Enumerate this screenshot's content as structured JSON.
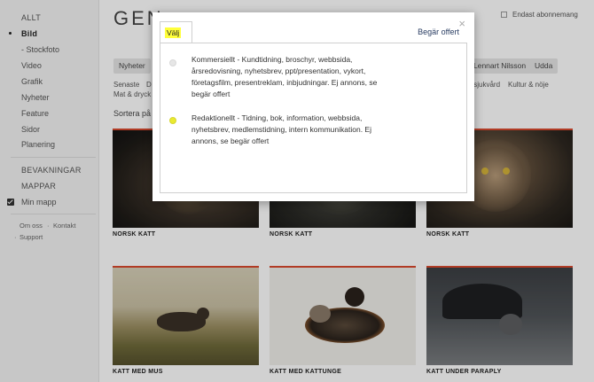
{
  "sidebar": {
    "items": [
      {
        "label": "ALLT"
      },
      {
        "label": "Bild"
      },
      {
        "label": "- Stockfoto"
      },
      {
        "label": "Video"
      },
      {
        "label": "Grafik"
      },
      {
        "label": "Nyheter"
      },
      {
        "label": "Feature"
      },
      {
        "label": "Sidor"
      },
      {
        "label": "Planering"
      }
    ],
    "sections": [
      "BEVAKNINGAR",
      "MAPPAR"
    ],
    "my_folder": "Min mapp",
    "footer": {
      "about": "Om oss",
      "contact": "Kontakt",
      "support": "Support"
    }
  },
  "main": {
    "title": "GEN",
    "subscription_label": "Endast abonnemang",
    "tags": [
      "Nyheter",
      "Lennart Nilsson",
      "Udda"
    ],
    "links": {
      "latest": "Senaste",
      "latest_d": "D",
      "sjukvard": "s sjukvård",
      "kultur": "Kultur & nöje",
      "mat": "Mat & dryck"
    },
    "sort_label": "Sortera på",
    "cards": [
      {
        "caption": "NORSK KATT"
      },
      {
        "caption": "NORSK KATT"
      },
      {
        "caption": "NORSK KATT"
      },
      {
        "caption": "KATT MED MUS"
      },
      {
        "caption": "KATT MED KATTUNGE"
      },
      {
        "caption": "KATT UNDER PARAPLY"
      }
    ]
  },
  "modal": {
    "tab_label": "Välj",
    "quote_link": "Begär offert",
    "close": "×",
    "options": [
      {
        "text": "Kommersiellt - Kundtidning, broschyr, webbsida, årsredovisning, nyhetsbrev, ppt/presentation, vykort, företagsfilm, presentreklam, inbjudningar. Ej annons, se begär offert",
        "selected": false
      },
      {
        "text": "Redaktionellt - Tidning, bok, information, webbsida, nyhetsbrev, medlemstidning, intern kommunikation. Ej annons, se begär offert",
        "selected": true
      }
    ]
  },
  "colors": {
    "accent_line": "#d8482e",
    "highlight": "#ffff3b",
    "link": "#2a3e63"
  }
}
